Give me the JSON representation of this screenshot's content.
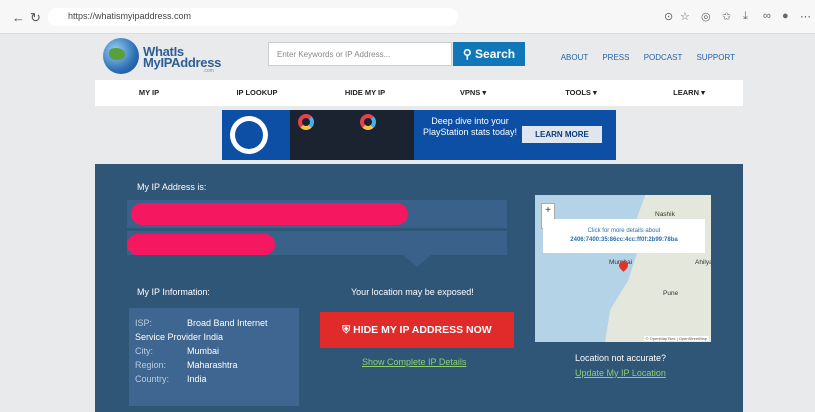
{
  "browser": {
    "url": "https://whatismyipaddress.com",
    "icons": [
      "back-icon",
      "refresh-icon",
      "lock-icon",
      "reader-icon",
      "favorite-icon",
      "extensions-icon",
      "favorites-bar-icon",
      "download-icon",
      "share-icon",
      "profile-icon",
      "more-icon"
    ]
  },
  "header": {
    "logo_line1": "WhatIs",
    "logo_line2": "MyIPAddress",
    "logo_suffix": ".com",
    "search_placeholder": "Enter Keywords or IP Address...",
    "search_button": "Search",
    "links": [
      "ABOUT",
      "PRESS",
      "PODCAST",
      "SUPPORT"
    ]
  },
  "menu": [
    "MY IP",
    "IP LOOKUP",
    "HIDE MY IP",
    "VPNS ▾",
    "TOOLS ▾",
    "LEARN ▾"
  ],
  "ad": {
    "text": "Deep dive into your PlayStation stats today!",
    "button": "LEARN MORE"
  },
  "main": {
    "ip_label": "My IP Address is:",
    "info_label": "My IP Information:",
    "exposed": "Your location may be exposed!",
    "hide_button": "HIDE MY IP ADDRESS NOW",
    "show_details": "Show Complete IP Details",
    "not_accurate": "Location not accurate?",
    "update_link": "Update My IP Location",
    "info": {
      "isp_key": "ISP:",
      "isp_val": "Broad Band Internet",
      "isp_val2": "Service Provider India",
      "city_key": "City:",
      "city_val": "Mumbai",
      "region_key": "Region:",
      "region_val": "Maharashtra",
      "country_key": "Country:",
      "country_val": "India"
    }
  },
  "map": {
    "popup_line1": "Click for more details about",
    "popup_line2": "2406:7400:35:86cc:4cc:ff0f:2b99:78ba",
    "labels": [
      "Nashik",
      "Mumbai",
      "Ahilyanagar",
      "Pune"
    ],
    "attribution": "© OpenMapTiles | OpenStreetMap"
  },
  "colors": {
    "accent": "#1277b8",
    "panel": "#2f5577",
    "hide": "#e12a2a",
    "redact": "#f5175f",
    "link": "#8fcf72"
  }
}
